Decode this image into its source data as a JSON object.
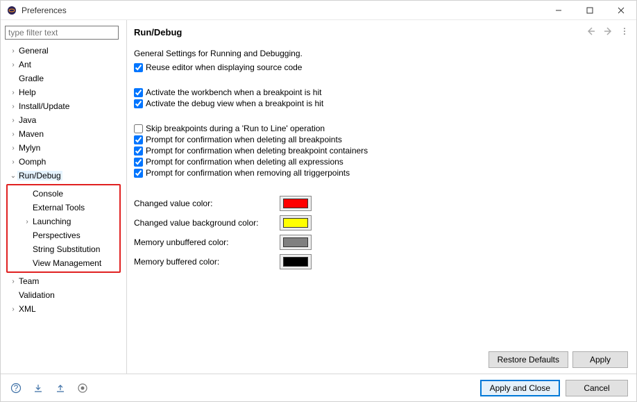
{
  "window": {
    "title": "Preferences"
  },
  "sidebar": {
    "filter_placeholder": "type filter text",
    "items": {
      "general": "General",
      "ant": "Ant",
      "gradle": "Gradle",
      "help": "Help",
      "install_update": "Install/Update",
      "java": "Java",
      "maven": "Maven",
      "mylyn": "Mylyn",
      "oomph": "Oomph",
      "run_debug": "Run/Debug",
      "console": "Console",
      "external_tools": "External Tools",
      "launching": "Launching",
      "perspectives": "Perspectives",
      "string_substitution": "String Substitution",
      "view_management": "View Management",
      "team": "Team",
      "validation": "Validation",
      "xml": "XML"
    }
  },
  "main": {
    "heading": "Run/Debug",
    "desc": "General Settings for Running and Debugging.",
    "checks": {
      "reuse_editor": "Reuse editor when displaying source code",
      "activate_workbench": "Activate the workbench when a breakpoint is hit",
      "activate_debug_view": "Activate the debug view when a breakpoint is hit",
      "skip_breakpoints": "Skip breakpoints during a 'Run to Line' operation",
      "prompt_delete_all_bp": "Prompt for confirmation when deleting all breakpoints",
      "prompt_delete_bp_containers": "Prompt for confirmation when deleting breakpoint containers",
      "prompt_delete_expressions": "Prompt for confirmation when deleting all expressions",
      "prompt_remove_triggerpoints": "Prompt for confirmation when removing all triggerpoints"
    },
    "colors": {
      "changed_value": {
        "label": "Changed value color:",
        "hex": "#ff0000"
      },
      "changed_bg": {
        "label": "Changed value background color:",
        "hex": "#ffff00"
      },
      "mem_unbuffered": {
        "label": "Memory unbuffered color:",
        "hex": "#808080"
      },
      "mem_buffered": {
        "label": "Memory buffered color:",
        "hex": "#000000"
      }
    },
    "buttons": {
      "restore_defaults": "Restore Defaults",
      "apply": "Apply",
      "apply_close": "Apply and Close",
      "cancel": "Cancel"
    }
  }
}
